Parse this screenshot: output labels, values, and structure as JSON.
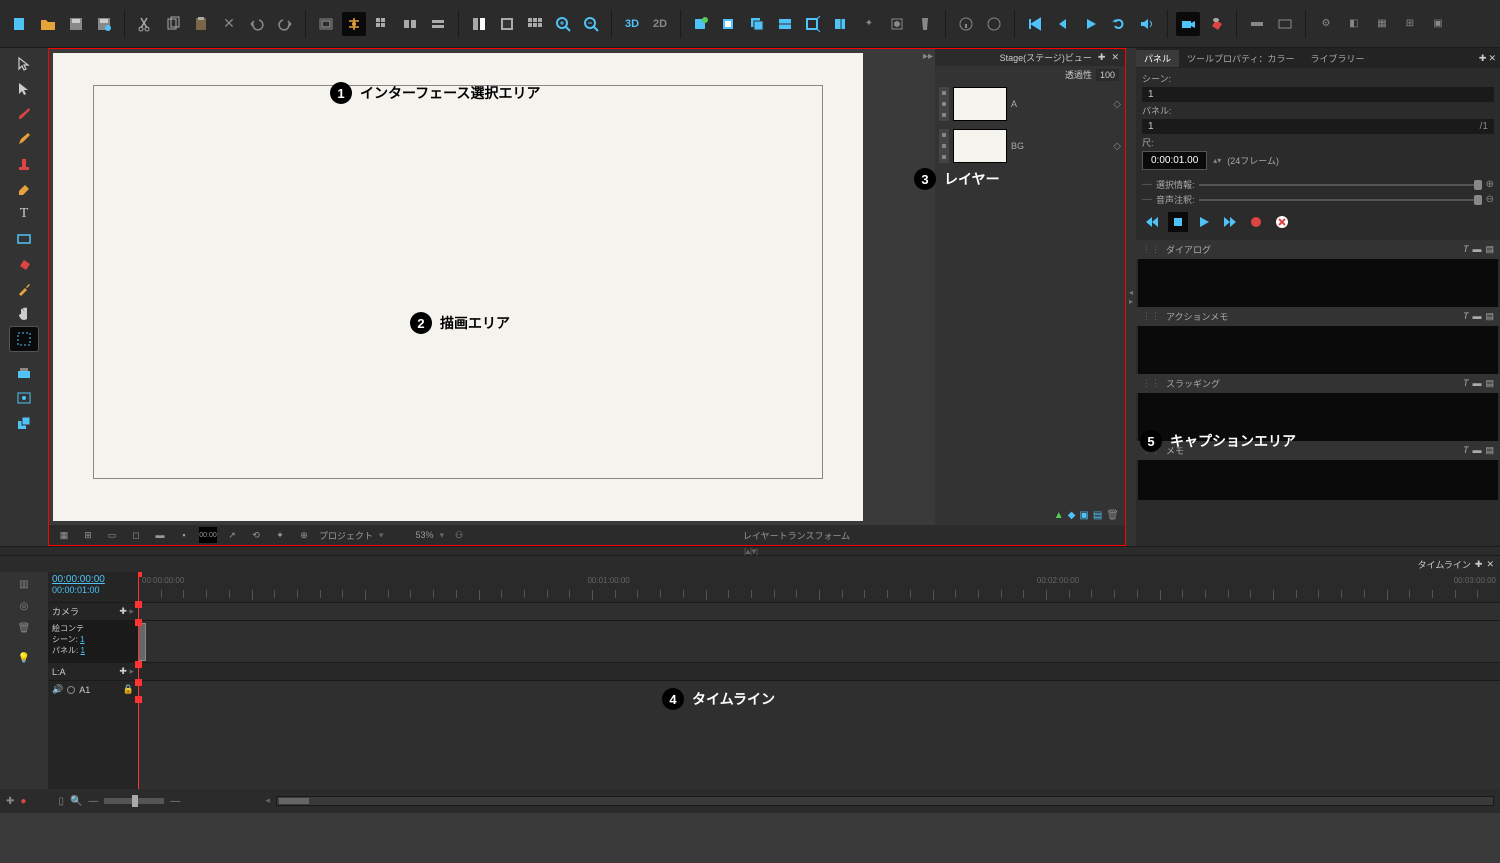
{
  "annotations": {
    "a1": "インターフェース選択エリア",
    "a2": "描画エリア",
    "a3": "レイヤー",
    "a4": "タイムライン",
    "a5": "キャプションエリア"
  },
  "stage": {
    "title": "Stage(ステージ)ビュー",
    "opacity_label": "透過性",
    "opacity_value": "100"
  },
  "layers": {
    "items": [
      {
        "name": "A"
      },
      {
        "name": "BG"
      }
    ]
  },
  "stage_footer": {
    "project_label": "プロジェクト",
    "zoom": "53%",
    "center_label": "レイヤートランスフォーム"
  },
  "right_panel": {
    "tabs": {
      "panel": "パネル",
      "tool_props": "ツールプロパティ：カラー",
      "library": "ライブラリー"
    },
    "scene_label": "シーン:",
    "scene_value": "1",
    "panel_label": "パネル:",
    "panel_value": "1",
    "panel_total": "/1",
    "duration_label": "尺:",
    "tc_value": "0:00:01.00",
    "frames_label": "(24フレーム)",
    "slider1_label": "選択情報:",
    "slider2_label": "音声注釈:",
    "captions": {
      "dialog": "ダイアログ",
      "action": "アクションメモ",
      "slugging": "スラッギング",
      "notes": "メモ"
    }
  },
  "timeline": {
    "title": "タイムライン",
    "tc_main": "00:00:00:00",
    "tc_sub": "00:00:01:00",
    "markers": {
      "m0": "00:00:00:00",
      "m1": "00:01:00:00",
      "m2": "00:02:00:00",
      "m3": "00:03:00:00"
    },
    "tracks": {
      "camera": "カメラ",
      "storyboard": "絵コンテ",
      "scene_label": "シーン:",
      "scene_val": "1",
      "panel_label": "パネル:",
      "panel_val": "1",
      "la": "L:A",
      "a1": "A1"
    }
  },
  "colors": {
    "accent_blue": "#4fc3f7",
    "accent_red": "#ff3333"
  }
}
